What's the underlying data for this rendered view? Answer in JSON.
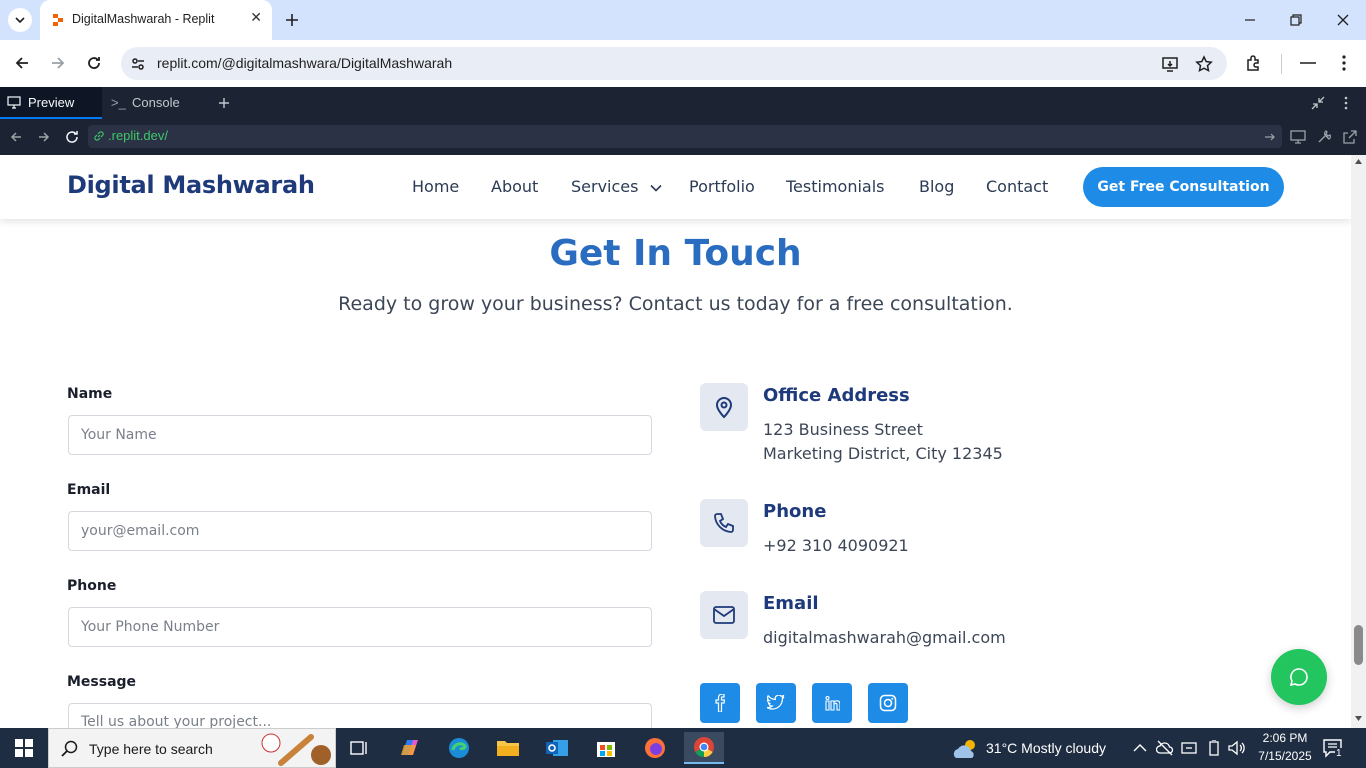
{
  "browser": {
    "tab_title": "DigitalMashwarah - Replit",
    "url": "replit.com/@digitalmashwara/DigitalMashwarah"
  },
  "replit": {
    "tab_preview": "Preview",
    "tab_console": "Console",
    "dev_url": ".replit.dev/"
  },
  "site": {
    "brand": "Digital Mashwarah",
    "nav": {
      "home": "Home",
      "about": "About",
      "services": "Services",
      "portfolio": "Portfolio",
      "testimonials": "Testimonials",
      "blog": "Blog",
      "contact": "Contact"
    },
    "cta": "Get Free Consultation",
    "heading": "Get In Touch",
    "subheading": "Ready to grow your business? Contact us today for a free consultation.",
    "form": {
      "name_label": "Name",
      "name_placeholder": "Your Name",
      "email_label": "Email",
      "email_placeholder": "your@email.com",
      "phone_label": "Phone",
      "phone_placeholder": "Your Phone Number",
      "message_label": "Message",
      "message_placeholder": "Tell us about your project..."
    },
    "contact": {
      "office_title": "Office Address",
      "office_line1": "123 Business Street",
      "office_line2": "Marketing District, City 12345",
      "phone_title": "Phone",
      "phone_value": "+92 310 4090921",
      "email_title": "Email",
      "email_value": "digitalmashwarah@gmail.com"
    }
  },
  "taskbar": {
    "search_placeholder": "Type here to search",
    "weather": "31°C  Mostly cloudy",
    "time": "2:06 PM",
    "date": "7/15/2025",
    "notifications": "1"
  },
  "colors": {
    "brand": "#1e3a7a",
    "heading": "#2a6cc0",
    "accent": "#1e8ce6",
    "chat": "#22c55e"
  }
}
